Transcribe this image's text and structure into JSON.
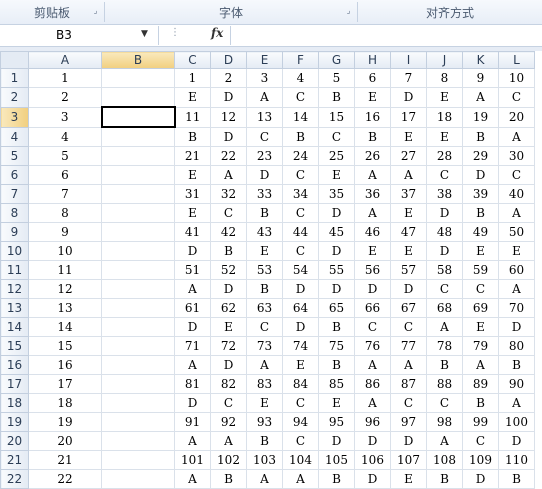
{
  "ribbon": {
    "groups": [
      {
        "label": "剪贴板"
      },
      {
        "label": "字体"
      },
      {
        "label": "对齐方式"
      }
    ]
  },
  "formula_bar": {
    "name_box": "B3",
    "fx_label": "fx",
    "formula": ""
  },
  "sheet": {
    "selected_cell": "B3",
    "columns": [
      "",
      "A",
      "B",
      "C",
      "D",
      "E",
      "F",
      "G",
      "H",
      "I",
      "J",
      "K",
      "L"
    ],
    "rows": [
      [
        "1",
        "1",
        "",
        "1",
        "2",
        "3",
        "4",
        "5",
        "6",
        "7",
        "8",
        "9",
        "10"
      ],
      [
        "2",
        "2",
        "",
        "E",
        "D",
        "A",
        "C",
        "B",
        "E",
        "D",
        "E",
        "A",
        "C"
      ],
      [
        "3",
        "3",
        "",
        "11",
        "12",
        "13",
        "14",
        "15",
        "16",
        "17",
        "18",
        "19",
        "20"
      ],
      [
        "4",
        "4",
        "",
        "B",
        "D",
        "C",
        "B",
        "C",
        "B",
        "E",
        "E",
        "B",
        "A"
      ],
      [
        "5",
        "5",
        "",
        "21",
        "22",
        "23",
        "24",
        "25",
        "26",
        "27",
        "28",
        "29",
        "30"
      ],
      [
        "6",
        "6",
        "",
        "E",
        "A",
        "D",
        "C",
        "E",
        "A",
        "A",
        "C",
        "D",
        "C"
      ],
      [
        "7",
        "7",
        "",
        "31",
        "32",
        "33",
        "34",
        "35",
        "36",
        "37",
        "38",
        "39",
        "40"
      ],
      [
        "8",
        "8",
        "",
        "E",
        "C",
        "B",
        "C",
        "D",
        "A",
        "E",
        "D",
        "B",
        "A"
      ],
      [
        "9",
        "9",
        "",
        "41",
        "42",
        "43",
        "44",
        "45",
        "46",
        "47",
        "48",
        "49",
        "50"
      ],
      [
        "10",
        "10",
        "",
        "D",
        "B",
        "E",
        "C",
        "D",
        "E",
        "E",
        "D",
        "E",
        "E"
      ],
      [
        "11",
        "11",
        "",
        "51",
        "52",
        "53",
        "54",
        "55",
        "56",
        "57",
        "58",
        "59",
        "60"
      ],
      [
        "12",
        "12",
        "",
        "A",
        "D",
        "B",
        "D",
        "D",
        "D",
        "D",
        "C",
        "C",
        "A"
      ],
      [
        "13",
        "13",
        "",
        "61",
        "62",
        "63",
        "64",
        "65",
        "66",
        "67",
        "68",
        "69",
        "70"
      ],
      [
        "14",
        "14",
        "",
        "D",
        "E",
        "C",
        "D",
        "B",
        "C",
        "C",
        "A",
        "E",
        "D"
      ],
      [
        "15",
        "15",
        "",
        "71",
        "72",
        "73",
        "74",
        "75",
        "76",
        "77",
        "78",
        "79",
        "80"
      ],
      [
        "16",
        "16",
        "",
        "A",
        "D",
        "A",
        "E",
        "B",
        "A",
        "A",
        "B",
        "A",
        "B"
      ],
      [
        "17",
        "17",
        "",
        "81",
        "82",
        "83",
        "84",
        "85",
        "86",
        "87",
        "88",
        "89",
        "90"
      ],
      [
        "18",
        "18",
        "",
        "D",
        "C",
        "E",
        "C",
        "E",
        "A",
        "C",
        "C",
        "B",
        "A"
      ],
      [
        "19",
        "19",
        "",
        "91",
        "92",
        "93",
        "94",
        "95",
        "96",
        "97",
        "98",
        "99",
        "100"
      ],
      [
        "20",
        "20",
        "",
        "A",
        "A",
        "B",
        "C",
        "D",
        "D",
        "D",
        "A",
        "C",
        "D"
      ],
      [
        "21",
        "21",
        "",
        "101",
        "102",
        "103",
        "104",
        "105",
        "106",
        "107",
        "108",
        "109",
        "110"
      ],
      [
        "22",
        "22",
        "",
        "A",
        "B",
        "A",
        "A",
        "B",
        "D",
        "E",
        "B",
        "D",
        "B"
      ]
    ]
  }
}
